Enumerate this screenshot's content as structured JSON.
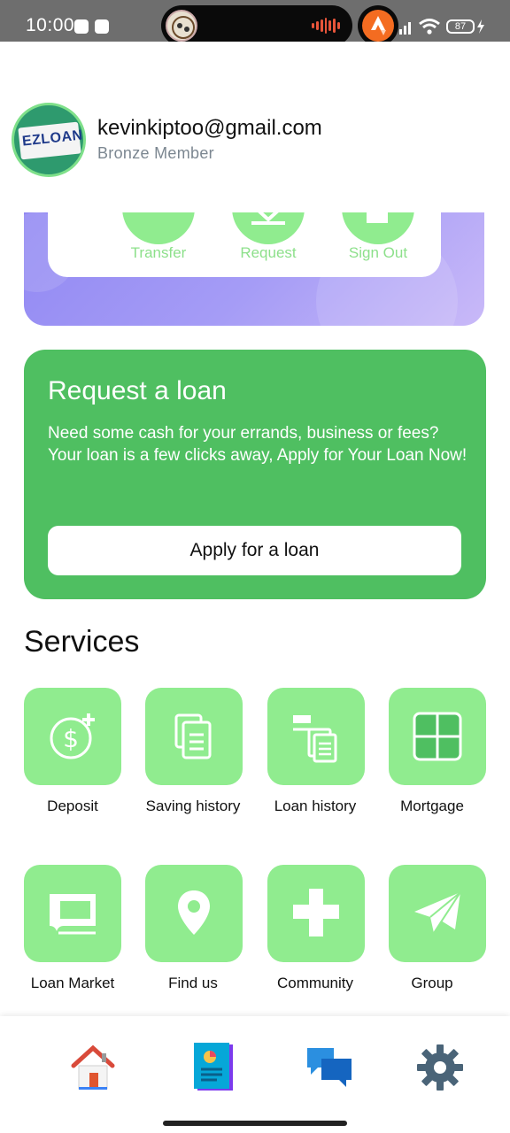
{
  "status_bar": {
    "time": "10:00",
    "battery": "87"
  },
  "profile": {
    "email": "kevinkiptoo@gmail.com",
    "tier": "Bronze Member",
    "logo_text": "EZLOAN"
  },
  "quick_actions": [
    {
      "label": "Transfer",
      "icon": "transfer-icon"
    },
    {
      "label": "Request",
      "icon": "request-icon"
    },
    {
      "label": "Sign Out",
      "icon": "sign-out-icon"
    }
  ],
  "loan_card": {
    "title": "Request a loan",
    "description": "Need some cash for your errands, business or fees? Your loan is a few clicks away, Apply for Your Loan Now!",
    "button_label": "Apply for a loan"
  },
  "services": {
    "title": "Services",
    "items": [
      {
        "label": "Deposit",
        "icon": "deposit-icon"
      },
      {
        "label": "Saving history",
        "icon": "saving-history-icon"
      },
      {
        "label": "Loan history",
        "icon": "loan-history-icon"
      },
      {
        "label": "Mortgage",
        "icon": "mortgage-icon"
      },
      {
        "label": "Loan Market",
        "icon": "loan-market-icon"
      },
      {
        "label": "Find us",
        "icon": "location-pin-icon"
      },
      {
        "label": "Community",
        "icon": "cross-icon"
      },
      {
        "label": "Group",
        "icon": "paper-plane-icon"
      }
    ]
  },
  "bottom_nav": [
    {
      "icon": "home-icon"
    },
    {
      "icon": "report-icon"
    },
    {
      "icon": "chat-icon"
    },
    {
      "icon": "settings-gear-icon"
    }
  ],
  "colors": {
    "brand_green": "#4fbf61",
    "tile_green": "#90ec8f",
    "banner_purple": "#8f86f2"
  }
}
